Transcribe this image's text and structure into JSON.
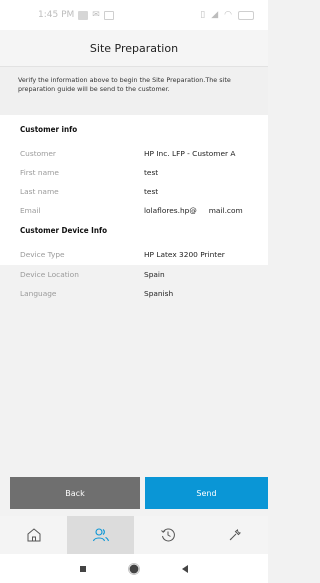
{
  "status_bar": {
    "time": "1:45 PM"
  },
  "header": {
    "title": "Site Preparation"
  },
  "intro": {
    "text": "Verify the information above to begin the Site Preparation.The site preparation guide will be send to the customer."
  },
  "customer_info": {
    "title": "Customer info",
    "rows": [
      {
        "label": "Customer",
        "value": "HP Inc. LFP - Customer A"
      },
      {
        "label": "First name",
        "value": "test"
      },
      {
        "label": "Last name",
        "value": "test"
      },
      {
        "label": "Email",
        "value": "lolaflores.hp@",
        "value2": "mail.com"
      }
    ]
  },
  "device_info": {
    "title": "Customer Device Info",
    "rows": [
      {
        "label": "Device Type",
        "value": "HP Latex 3200 Printer"
      },
      {
        "label": "Device Location",
        "value": "Spain"
      },
      {
        "label": "Language",
        "value": "Spanish"
      }
    ]
  },
  "actions": {
    "back_label": "Back",
    "send_label": "Send"
  },
  "tabs": [
    {
      "icon": "home-icon",
      "active": false
    },
    {
      "icon": "users-icon",
      "active": true
    },
    {
      "icon": "history-icon",
      "active": false
    },
    {
      "icon": "wrench-icon",
      "active": false
    }
  ],
  "colors": {
    "accent": "#0a96d6",
    "back_button": "#6f6f6f",
    "active_tab": "#dcdcdc"
  }
}
